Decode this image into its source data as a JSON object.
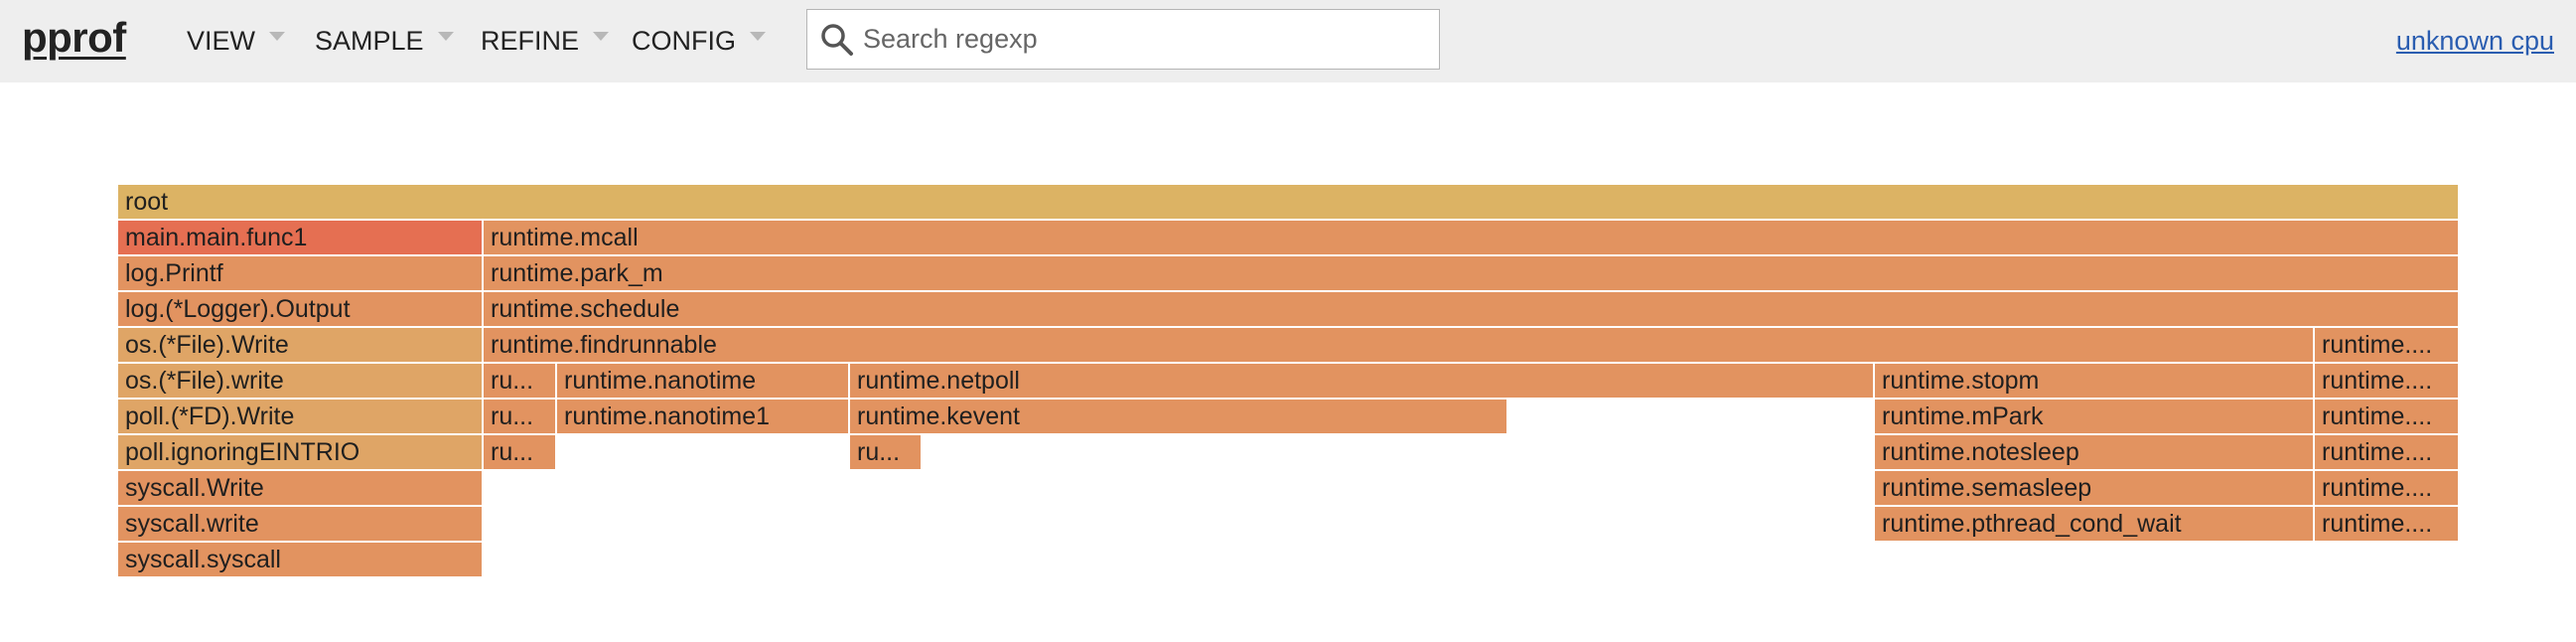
{
  "header": {
    "logo": "pprof",
    "menus": [
      "VIEW",
      "SAMPLE",
      "REFINE",
      "CONFIG"
    ],
    "search": {
      "placeholder": "Search regexp",
      "value": ""
    },
    "profile_label": "unknown cpu"
  },
  "colors": {
    "header_bg": "#eeeeee",
    "link": "#2a5db0",
    "root": "#dcb364",
    "hot": "#e56f52",
    "warm": "#e29360",
    "tan": "#dfa566"
  },
  "flamegraph": {
    "frames": [
      {
        "label": "root",
        "color": "root"
      },
      {
        "label": "main.main.func1",
        "color": "hot"
      },
      {
        "label": "runtime.mcall",
        "color": "warm"
      },
      {
        "label": "log.Printf",
        "color": "warm"
      },
      {
        "label": "runtime.park_m",
        "color": "warm"
      },
      {
        "label": "log.(*Logger).Output",
        "color": "warm"
      },
      {
        "label": "runtime.schedule",
        "color": "warm"
      },
      {
        "label": "os.(*File).Write",
        "color": "tan"
      },
      {
        "label": "runtime.findrunnable",
        "color": "warm"
      },
      {
        "label": "runtime....",
        "color": "warm"
      },
      {
        "label": "os.(*File).write",
        "color": "tan"
      },
      {
        "label": "ru...",
        "color": "warm"
      },
      {
        "label": "runtime.nanotime",
        "color": "warm"
      },
      {
        "label": "runtime.netpoll",
        "color": "warm"
      },
      {
        "label": "runtime.stopm",
        "color": "warm"
      },
      {
        "label": "runtime....",
        "color": "warm"
      },
      {
        "label": "poll.(*FD).Write",
        "color": "tan"
      },
      {
        "label": "ru...",
        "color": "warm"
      },
      {
        "label": "runtime.nanotime1",
        "color": "warm"
      },
      {
        "label": "runtime.kevent",
        "color": "warm"
      },
      {
        "label": "runtime.mPark",
        "color": "warm"
      },
      {
        "label": "runtime....",
        "color": "warm"
      },
      {
        "label": "poll.ignoringEINTRIO",
        "color": "tan"
      },
      {
        "label": "ru...",
        "color": "warm"
      },
      {
        "label": "ru...",
        "color": "warm"
      },
      {
        "label": "runtime.notesleep",
        "color": "warm"
      },
      {
        "label": "runtime....",
        "color": "warm"
      },
      {
        "label": "syscall.Write",
        "color": "warm"
      },
      {
        "label": "runtime.semasleep",
        "color": "warm"
      },
      {
        "label": "runtime....",
        "color": "warm"
      },
      {
        "label": "syscall.write",
        "color": "warm"
      },
      {
        "label": "runtime.pthread_cond_wait",
        "color": "warm"
      },
      {
        "label": "runtime....",
        "color": "warm"
      },
      {
        "label": "syscall.syscall",
        "color": "warm"
      }
    ]
  }
}
